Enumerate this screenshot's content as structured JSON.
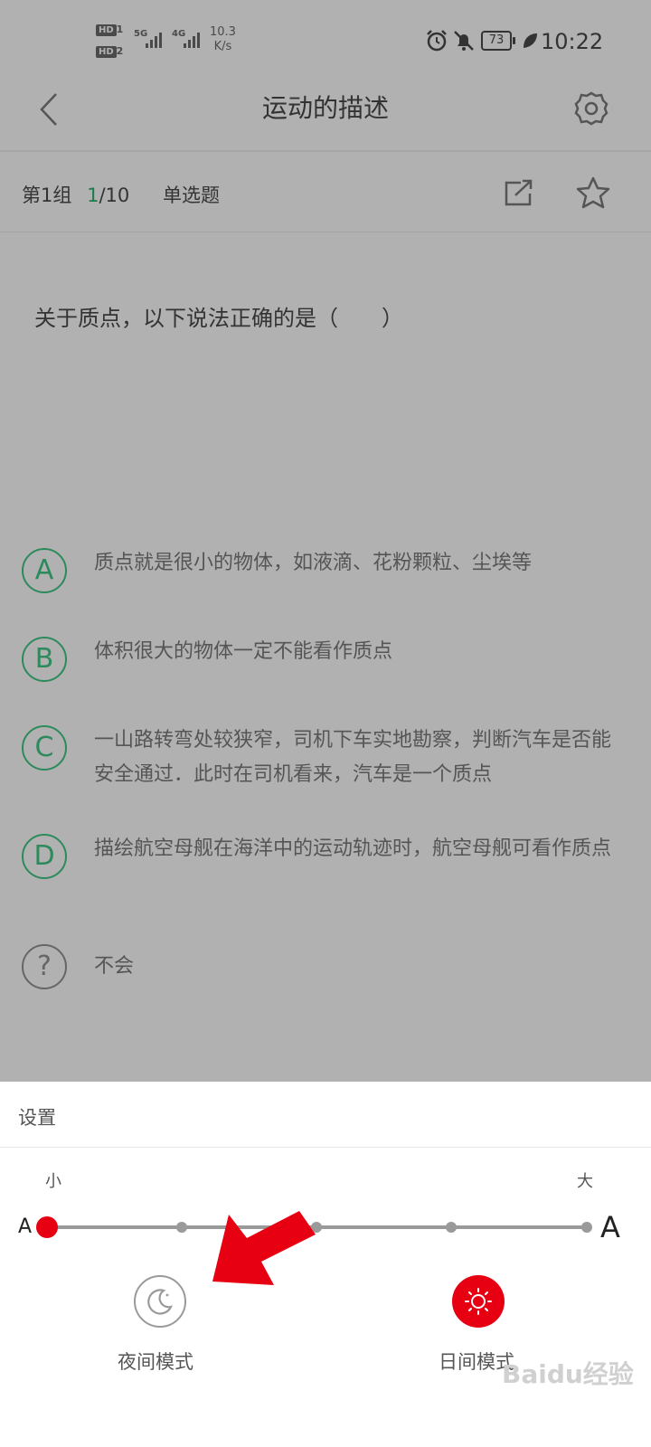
{
  "status_bar": {
    "sim1": "HD",
    "sim1_num": "1",
    "sim2": "HD",
    "sim2_num": "2",
    "net1": "5G",
    "net2": "4G",
    "speed_value": "10.3",
    "speed_unit": "K/s",
    "battery": "73",
    "time": "10:22"
  },
  "header": {
    "title": "运动的描述"
  },
  "subbar": {
    "group": "第1组",
    "current": "1",
    "total": "/10",
    "type": "单选题"
  },
  "question": {
    "text": "关于质点，以下说法正确的是（　　）"
  },
  "options": [
    {
      "letter": "A",
      "text": "质点就是很小的物体，如液滴、花粉颗粒、尘埃等"
    },
    {
      "letter": "B",
      "text": "体积很大的物体一定不能看作质点"
    },
    {
      "letter": "C",
      "text": "一山路转弯处较狭窄，司机下车实地勘察，判断汽车是否能安全通过．此时在司机看来，汽车是一个质点"
    },
    {
      "letter": "D",
      "text": "描绘航空母舰在海洋中的运动轨迹时，航空母舰可看作质点"
    },
    {
      "letter": "?",
      "text": "不会"
    }
  ],
  "settings": {
    "title": "设置",
    "small_label": "小",
    "large_label": "大",
    "small_a": "A",
    "large_a": "A",
    "font_size_level": "1 of 5",
    "night_mode_label": "夜间模式",
    "day_mode_label": "日间模式",
    "selected_mode": "day"
  },
  "watermark": "Baidu经验",
  "colors": {
    "accent": "#e60012",
    "option_green": "#2d8a5c",
    "overlay": "#b1b1b1"
  }
}
